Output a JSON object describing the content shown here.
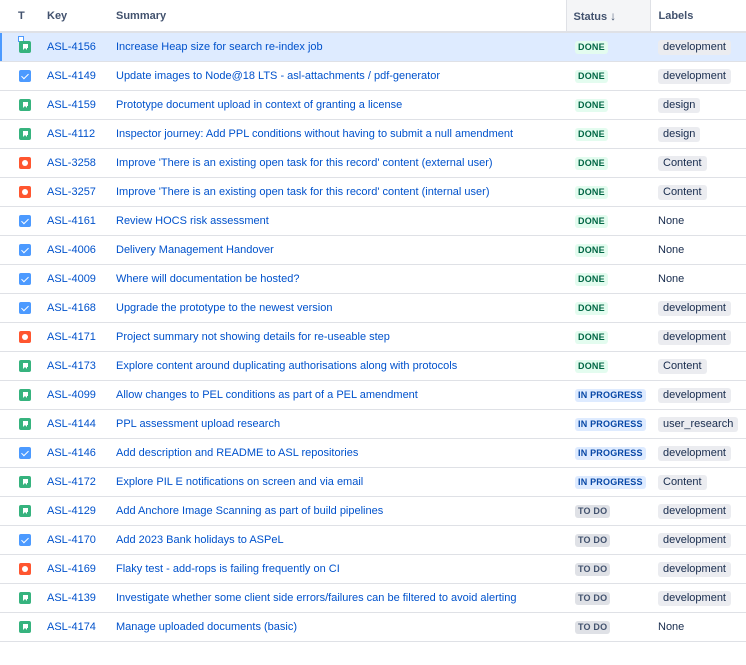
{
  "table": {
    "headers": {
      "type": "T",
      "key": "Key",
      "summary": "Summary",
      "status": "Status",
      "labels": "Labels"
    },
    "rows": [
      {
        "type": "story",
        "key": "ASL-4156",
        "summary": "Increase Heap size for search re-index job",
        "status": "DONE",
        "labels": "development",
        "selected": true
      },
      {
        "type": "task",
        "key": "ASL-4149",
        "summary": "Update images to Node@18 LTS - asl-attachments / pdf-generator",
        "status": "DONE",
        "labels": "development"
      },
      {
        "type": "story",
        "key": "ASL-4159",
        "summary": "Prototype document upload in context of granting a license",
        "status": "DONE",
        "labels": "design"
      },
      {
        "type": "story",
        "key": "ASL-4112",
        "summary": "Inspector journey: Add PPL conditions without having to submit a null amendment",
        "status": "DONE",
        "labels": "design"
      },
      {
        "type": "bug",
        "key": "ASL-3258",
        "summary": "Improve 'There is an existing open task for this record' content (external user)",
        "status": "DONE",
        "labels": "Content"
      },
      {
        "type": "bug",
        "key": "ASL-3257",
        "summary": "Improve 'There is an existing open task for this record' content (internal user)",
        "status": "DONE",
        "labels": "Content"
      },
      {
        "type": "task",
        "key": "ASL-4161",
        "summary": "Review HOCS risk assessment",
        "status": "DONE",
        "labels": "None"
      },
      {
        "type": "task",
        "key": "ASL-4006",
        "summary": "Delivery Management Handover",
        "status": "DONE",
        "labels": "None"
      },
      {
        "type": "task",
        "key": "ASL-4009",
        "summary": "Where will documentation be hosted?",
        "status": "DONE",
        "labels": "None"
      },
      {
        "type": "task",
        "key": "ASL-4168",
        "summary": "Upgrade the prototype to the newest version",
        "status": "DONE",
        "labels": "development"
      },
      {
        "type": "bug",
        "key": "ASL-4171",
        "summary": "Project summary not showing details for re-useable step",
        "status": "DONE",
        "labels": "development"
      },
      {
        "type": "story",
        "key": "ASL-4173",
        "summary": "Explore content around duplicating authorisations along with protocols",
        "status": "DONE",
        "labels": "Content"
      },
      {
        "type": "story",
        "key": "ASL-4099",
        "summary": "Allow changes to PEL conditions as part of a PEL amendment",
        "status": "IN PROGRESS",
        "labels": "development"
      },
      {
        "type": "story",
        "key": "ASL-4144",
        "summary": "PPL assessment upload research",
        "status": "IN PROGRESS",
        "labels": "user_research"
      },
      {
        "type": "task",
        "key": "ASL-4146",
        "summary": "Add description and README to ASL repositories",
        "status": "IN PROGRESS",
        "labels": "development"
      },
      {
        "type": "story",
        "key": "ASL-4172",
        "summary": "Explore PIL E notifications on screen and via email",
        "status": "IN PROGRESS",
        "labels": "Content"
      },
      {
        "type": "story",
        "key": "ASL-4129",
        "summary": "Add Anchore Image Scanning as part of build pipelines",
        "status": "TO DO",
        "labels": "development"
      },
      {
        "type": "task",
        "key": "ASL-4170",
        "summary": "Add 2023 Bank holidays to ASPeL",
        "status": "TO DO",
        "labels": "development"
      },
      {
        "type": "bug",
        "key": "ASL-4169",
        "summary": "Flaky test - add-rops is failing frequently on CI",
        "status": "TO DO",
        "labels": "development"
      },
      {
        "type": "story",
        "key": "ASL-4139",
        "summary": "Investigate whether some client side errors/failures can be filtered to avoid alerting",
        "status": "TO DO",
        "labels": "development"
      },
      {
        "type": "story",
        "key": "ASL-4174",
        "summary": "Manage uploaded documents (basic)",
        "status": "TO DO",
        "labels": "None"
      }
    ]
  },
  "icons": {
    "sort": "arrow-down-icon",
    "story": "story-icon",
    "task": "task-checkbox-icon",
    "bug": "bug-icon"
  },
  "colors": {
    "link": "#0052cc",
    "story": "#36b37e",
    "task": "#4c9aff",
    "bug": "#ff5630",
    "done_bg": "#e3fcef",
    "done_text": "#006644",
    "inprogress_bg": "#deebff",
    "inprogress_text": "#0747a6",
    "todo_bg": "#dfe1e6",
    "todo_text": "#42526e",
    "selected_row": "#deebff"
  }
}
